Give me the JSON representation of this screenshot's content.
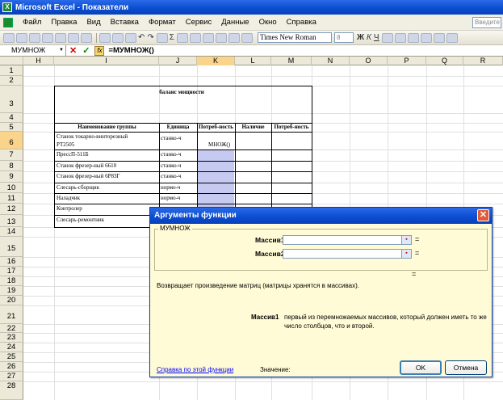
{
  "window": {
    "title": "Microsoft Excel - Показатели",
    "logo": "X"
  },
  "menu": {
    "items": [
      "Файл",
      "Правка",
      "Вид",
      "Вставка",
      "Формат",
      "Сервис",
      "Данные",
      "Окно",
      "Справка"
    ],
    "ask_placeholder": "Введите"
  },
  "toolbar": {
    "font_name": "Times New Roman",
    "font_size": "8"
  },
  "formula_bar": {
    "name_box": "МУМНОЖ",
    "cancel": "✕",
    "enter": "✓",
    "fx": "fx",
    "formula": "=МУМНОЖ()"
  },
  "sheet": {
    "columns": [
      "H",
      "I",
      "J",
      "K",
      "L",
      "M",
      "N",
      "O",
      "P",
      "Q",
      "R"
    ],
    "active_column": "K",
    "rows": [
      "1",
      "2",
      "3",
      "4",
      "5",
      "6",
      "7",
      "8",
      "9",
      "10",
      "11",
      "12",
      "13",
      "14",
      "15",
      "16",
      "17",
      "18",
      "19",
      "20",
      "21",
      "22",
      "23",
      "24",
      "25",
      "26",
      "27",
      "28"
    ],
    "active_row": "6",
    "title": "баланс мощности",
    "headers": [
      "Наименование группы",
      "Единица",
      "Потреб-ность",
      "Наличие",
      "Потреб-ность"
    ],
    "table_rows": [
      {
        "name_line1": "Станок токарно-винторезный",
        "name_line2": "РТ2505",
        "unit": "станко-ч",
        "need": "МНОЖ()"
      },
      {
        "name_line1": "ПрессП-511Б",
        "unit": "станко-ч"
      },
      {
        "name_line1": "Станок фрезер-ный 6610",
        "unit": "станко-ч"
      },
      {
        "name_line1": "Станок фрезер-ный 6Р83Г",
        "unit": "станко-ч"
      },
      {
        "name_line1": "Слесарь-сборщик",
        "unit": "нормо-ч"
      },
      {
        "name_line1": "Наладчик",
        "unit": "нормо-ч"
      },
      {
        "name_line1": "Контролер",
        "unit": ""
      },
      {
        "name_line1": "Слесарь-ремонтник",
        "unit": ""
      }
    ]
  },
  "dialog": {
    "title": "Аргументы функции",
    "close": "✕",
    "function_name": "МУМНОЖ",
    "args": [
      {
        "label": "Массив1",
        "value": ""
      },
      {
        "label": "Массив2",
        "value": ""
      }
    ],
    "equals": "=",
    "description": "Возвращает произведение матриц (матрицы хранятся в массивах).",
    "arg_help_label": "Массив1",
    "arg_help_text_line1": "первый из перемножаемых массивов, который должен иметь то же",
    "arg_help_text_line2": "число столбцов, что и второй.",
    "help_link": "Справка по этой функции",
    "value_label": "Значение:",
    "ok": "OK",
    "cancel": "Отмена"
  }
}
